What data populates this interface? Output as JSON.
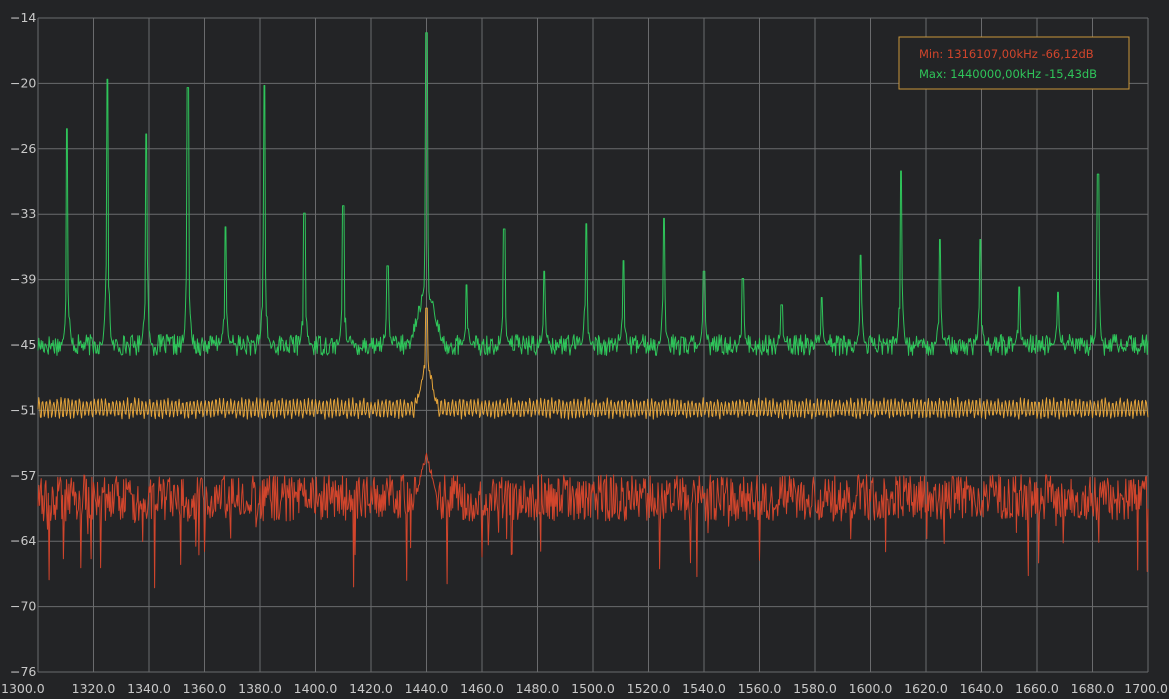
{
  "chart_data": {
    "type": "line",
    "title": "",
    "xlabel": "",
    "ylabel": "",
    "xlim": [
      1300,
      1700
    ],
    "ylim": [
      -76,
      -14
    ],
    "x_ticks": [
      "1300.0",
      "1320.0",
      "1340.0",
      "1360.0",
      "1380.0",
      "1400.0",
      "1420.0",
      "1440.0",
      "1460.0",
      "1480.0",
      "1500.0",
      "1520.0",
      "1540.0",
      "1560.0",
      "1580.0",
      "1600.0",
      "1620.0",
      "1640.0",
      "1660.0",
      "1680.0",
      "1700.0"
    ],
    "y_ticks": [
      "-14",
      "-20",
      "-26",
      "-33",
      "-39",
      "-45",
      "-51",
      "-57",
      "-64",
      "-70",
      "-76"
    ],
    "grid": true,
    "legend": {
      "position": "top-right",
      "min_text": "Min: 1316107,00kHz -66,12dB",
      "max_text": "Max: 1440000,00kHz -15,43dB"
    },
    "colors": {
      "background": "#232426",
      "grid": "#6a6b6d",
      "max_hold": "#2fc45a",
      "average": "#e3a33a",
      "current": "#d1452c",
      "legend_border": "#c9963a"
    },
    "series": [
      {
        "role": "max-hold",
        "baseline": -45.0,
        "noise": 1.0,
        "peaks": [
          [
            1310.5,
            -24.5
          ],
          [
            1325.0,
            -19.8
          ],
          [
            1339.0,
            -25.0
          ],
          [
            1354.0,
            -20.6
          ],
          [
            1367.5,
            -33.8
          ],
          [
            1381.5,
            -20.4
          ],
          [
            1396.0,
            -32.5
          ],
          [
            1410.0,
            -31.8
          ],
          [
            1426.0,
            -37.5
          ],
          [
            1440.0,
            -15.4
          ],
          [
            1454.5,
            -39.3
          ],
          [
            1468.0,
            -34.0
          ],
          [
            1482.5,
            -38.0
          ],
          [
            1497.5,
            -33.5
          ],
          [
            1511.0,
            -37.0
          ],
          [
            1525.5,
            -33.0
          ],
          [
            1540.0,
            -38.0
          ],
          [
            1554.0,
            -38.7
          ],
          [
            1568.0,
            -41.2
          ],
          [
            1582.5,
            -40.5
          ],
          [
            1596.5,
            -36.5
          ],
          [
            1611.0,
            -28.5
          ],
          [
            1625.0,
            -35.0
          ],
          [
            1639.5,
            -35.0
          ],
          [
            1653.5,
            -39.5
          ],
          [
            1667.5,
            -40.0
          ],
          [
            1682.0,
            -28.8
          ]
        ]
      },
      {
        "role": "average",
        "baseline": -51.0,
        "noise": 0.8,
        "peaks": [
          [
            1440.0,
            -46.2
          ]
        ]
      },
      {
        "role": "current",
        "baseline": -59.5,
        "noise": 2.2,
        "peaks": [
          [
            1440.0,
            -55.5
          ]
        ]
      }
    ]
  }
}
